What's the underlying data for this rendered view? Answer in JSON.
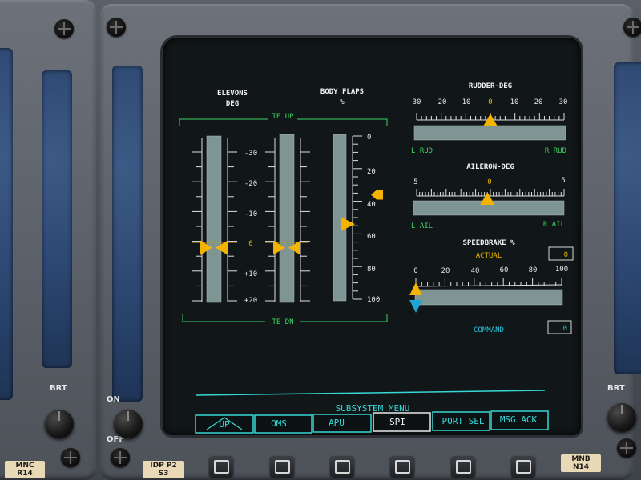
{
  "elevons": {
    "title_line1": "ELEVONS",
    "title_line2": "DEG",
    "te_up": "TE UP",
    "te_dn": "TE DN",
    "scale": [
      "-30",
      "-20",
      "-10",
      "0",
      "+10",
      "+20"
    ],
    "left_position_deg": 0,
    "right_position_deg": 0
  },
  "body_flaps": {
    "title": "BODY FLAPS",
    "unit": "%",
    "scale": [
      "0",
      "20",
      "40",
      "60",
      "80",
      "100"
    ],
    "position_pct": 54,
    "command_pct": 36
  },
  "rudder": {
    "title": "RUDDER-DEG",
    "scale": [
      "30",
      "20",
      "10",
      "0",
      "10",
      "20",
      "30"
    ],
    "left_label": "L RUD",
    "right_label": "R RUD",
    "position_deg": 0
  },
  "aileron": {
    "title": "AILERON-DEG",
    "scale": [
      "5",
      "0",
      "5"
    ],
    "left_label": "L AIL",
    "right_label": "R AIL",
    "position_deg": -0.2
  },
  "speedbrake": {
    "title": "SPEEDBRAKE %",
    "actual_label": "ACTUAL",
    "actual_value": "0",
    "command_label": "COMMAND",
    "command_value": "0",
    "scale": [
      "0",
      "20",
      "40",
      "60",
      "80",
      "100"
    ],
    "actual_pct": 0,
    "command_pct": 0
  },
  "menu": {
    "title": "SUBSYSTEM MENU",
    "items": [
      "UP",
      "OMS",
      "APU",
      "SPI",
      "PORT SEL",
      "MSG ACK"
    ],
    "active": "SPI"
  },
  "panel": {
    "brt_left": "BRT",
    "brt_right": "BRT",
    "on_label": "ON",
    "off_label": "OFF",
    "placard_left_line1": "MNC",
    "placard_left_line2": "R14",
    "placard_mid_line1": "IDP P2",
    "placard_mid_line2": "S3",
    "placard_right_line1": "MNB",
    "placard_right_line2": "N14"
  },
  "colors": {
    "screen_bg": "#111618",
    "tape_fill": "#7f9593",
    "pointer_yellow": "#f4b300",
    "pointer_cyan": "#1fa4d6",
    "scale_green": "#3fd264",
    "menu_cyan": "#37d7d4"
  }
}
